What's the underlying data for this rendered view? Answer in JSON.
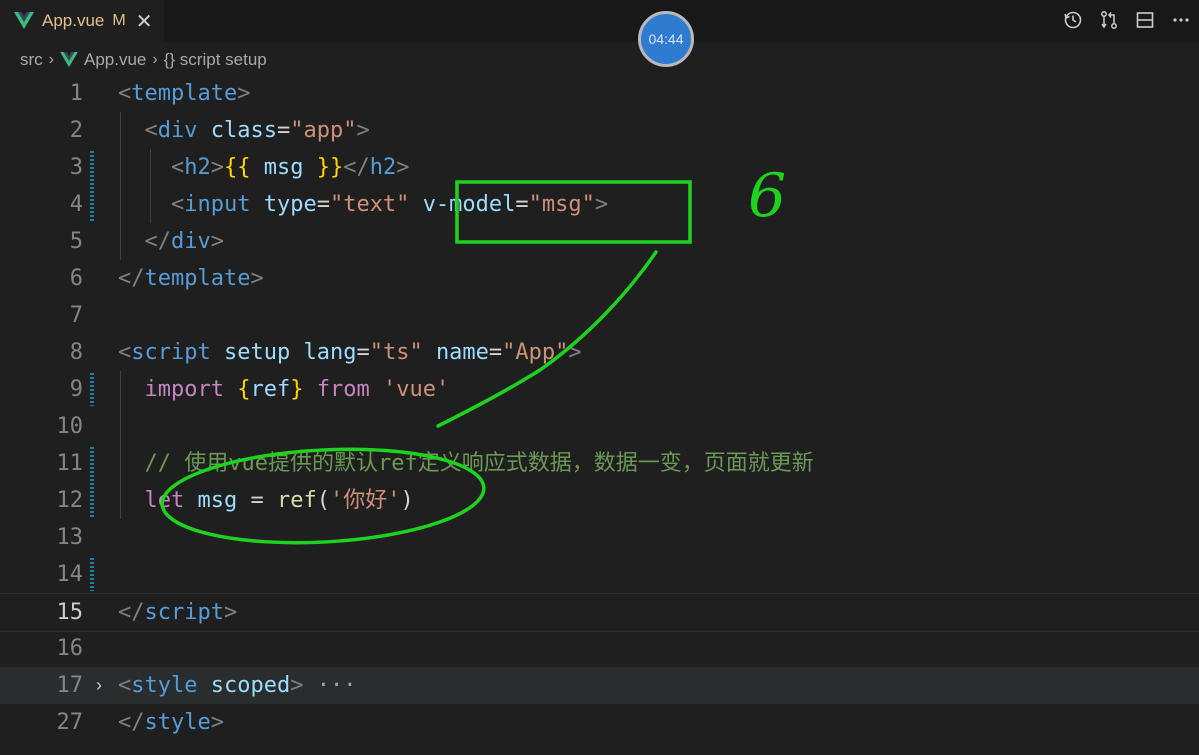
{
  "tab": {
    "name": "App.vue",
    "modified": "M",
    "close": "✕"
  },
  "timer": "04:44",
  "breadcrumb": {
    "src": "src",
    "file": "App.vue",
    "symbol": "{} script setup"
  },
  "annotation_number": "6",
  "lines": [
    {
      "num": "1",
      "tokens": [
        [
          "t-punct",
          "<"
        ],
        [
          "t-tag",
          "template"
        ],
        [
          "t-punct",
          ">"
        ]
      ]
    },
    {
      "num": "2",
      "tokens": [
        [
          "t-plain",
          "  "
        ],
        [
          "t-punct",
          "<"
        ],
        [
          "t-tag",
          "div"
        ],
        [
          "t-plain",
          " "
        ],
        [
          "t-attr",
          "class"
        ],
        [
          "t-plain",
          "="
        ],
        [
          "t-str",
          "\"app\""
        ],
        [
          "t-punct",
          ">"
        ]
      ]
    },
    {
      "num": "3",
      "tokens": [
        [
          "t-plain",
          "    "
        ],
        [
          "t-punct",
          "<"
        ],
        [
          "t-tag",
          "h2"
        ],
        [
          "t-punct",
          ">"
        ],
        [
          "t-brace",
          "{{"
        ],
        [
          "t-plain",
          " "
        ],
        [
          "t-var",
          "msg"
        ],
        [
          "t-plain",
          " "
        ],
        [
          "t-brace",
          "}}"
        ],
        [
          "t-punct",
          "</"
        ],
        [
          "t-tag",
          "h2"
        ],
        [
          "t-punct",
          ">"
        ]
      ]
    },
    {
      "num": "4",
      "tokens": [
        [
          "t-plain",
          "    "
        ],
        [
          "t-punct",
          "<"
        ],
        [
          "t-tag",
          "input"
        ],
        [
          "t-plain",
          " "
        ],
        [
          "t-attr",
          "type"
        ],
        [
          "t-plain",
          "="
        ],
        [
          "t-str",
          "\"text\""
        ],
        [
          "t-plain",
          " "
        ],
        [
          "t-attr",
          "v-model"
        ],
        [
          "t-plain",
          "="
        ],
        [
          "t-str",
          "\"msg\""
        ],
        [
          "t-punct",
          ">"
        ]
      ]
    },
    {
      "num": "5",
      "tokens": [
        [
          "t-plain",
          "  "
        ],
        [
          "t-punct",
          "</"
        ],
        [
          "t-tag",
          "div"
        ],
        [
          "t-punct",
          ">"
        ]
      ]
    },
    {
      "num": "6",
      "tokens": [
        [
          "t-punct",
          "</"
        ],
        [
          "t-tag",
          "template"
        ],
        [
          "t-punct",
          ">"
        ]
      ]
    },
    {
      "num": "7",
      "tokens": []
    },
    {
      "num": "8",
      "tokens": [
        [
          "t-punct",
          "<"
        ],
        [
          "t-tag",
          "script"
        ],
        [
          "t-plain",
          " "
        ],
        [
          "t-attr",
          "setup"
        ],
        [
          "t-plain",
          " "
        ],
        [
          "t-attr",
          "lang"
        ],
        [
          "t-plain",
          "="
        ],
        [
          "t-str",
          "\"ts\""
        ],
        [
          "t-plain",
          " "
        ],
        [
          "t-attr",
          "name"
        ],
        [
          "t-plain",
          "="
        ],
        [
          "t-str",
          "\"App\""
        ],
        [
          "t-punct",
          ">"
        ]
      ]
    },
    {
      "num": "9",
      "tokens": [
        [
          "t-plain",
          "  "
        ],
        [
          "t-kw",
          "import"
        ],
        [
          "t-plain",
          " "
        ],
        [
          "t-brace",
          "{"
        ],
        [
          "t-var",
          "ref"
        ],
        [
          "t-brace",
          "}"
        ],
        [
          "t-plain",
          " "
        ],
        [
          "t-kw",
          "from"
        ],
        [
          "t-plain",
          " "
        ],
        [
          "t-str",
          "'vue'"
        ]
      ]
    },
    {
      "num": "10",
      "tokens": []
    },
    {
      "num": "11",
      "tokens": [
        [
          "t-plain",
          "  "
        ],
        [
          "t-cmt",
          "// 使用vue提供的默认ref定义响应式数据，数据一变，页面就更新"
        ]
      ]
    },
    {
      "num": "12",
      "tokens": [
        [
          "t-plain",
          "  "
        ],
        [
          "t-kw",
          "let"
        ],
        [
          "t-plain",
          " "
        ],
        [
          "t-var",
          "msg"
        ],
        [
          "t-plain",
          " = "
        ],
        [
          "t-fn",
          "ref"
        ],
        [
          "t-plain",
          "("
        ],
        [
          "t-str",
          "'你好'"
        ],
        [
          "t-plain",
          ")"
        ]
      ]
    },
    {
      "num": "13",
      "tokens": []
    },
    {
      "num": "14",
      "tokens": []
    },
    {
      "num": "15",
      "tokens": [
        [
          "t-punct",
          "</"
        ],
        [
          "t-tag",
          "script"
        ],
        [
          "t-punct",
          ">"
        ]
      ]
    },
    {
      "num": "16",
      "tokens": []
    },
    {
      "num": "17",
      "tokens": [
        [
          "t-punct",
          "<"
        ],
        [
          "t-tag",
          "style"
        ],
        [
          "t-plain",
          " "
        ],
        [
          "t-attr",
          "scoped"
        ],
        [
          "t-punct",
          ">"
        ],
        [
          "dots",
          " ···"
        ]
      ]
    },
    {
      "num": "27",
      "tokens": [
        [
          "t-punct",
          "</"
        ],
        [
          "t-tag",
          "style"
        ],
        [
          "t-punct",
          ">"
        ]
      ]
    }
  ],
  "colors": {
    "annotation": "#1ed31e",
    "tab_text": "#e2c08d",
    "vue_green": "#41b883"
  },
  "icons": [
    "vue-logo-icon",
    "close-icon",
    "history-icon",
    "compare-changes-icon",
    "split-editor-icon",
    "more-actions-icon",
    "chevron-right-icon",
    "fold-chevron-icon"
  ]
}
